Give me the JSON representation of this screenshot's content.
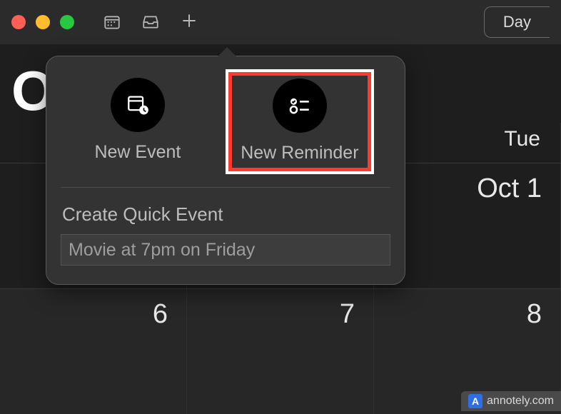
{
  "toolbar": {
    "view_mode_label": "Day"
  },
  "month": {
    "label_fragment": "O"
  },
  "weekdays": [
    "",
    "",
    "Tue"
  ],
  "row1": [
    "",
    "",
    "Oct 1"
  ],
  "row2": [
    "6",
    "7",
    "8"
  ],
  "popover": {
    "new_event_label": "New Event",
    "new_reminder_label": "New Reminder",
    "quick_event_heading": "Create Quick Event",
    "quick_event_placeholder": "Movie at 7pm on Friday"
  },
  "watermark": {
    "text": "annotely.com"
  }
}
